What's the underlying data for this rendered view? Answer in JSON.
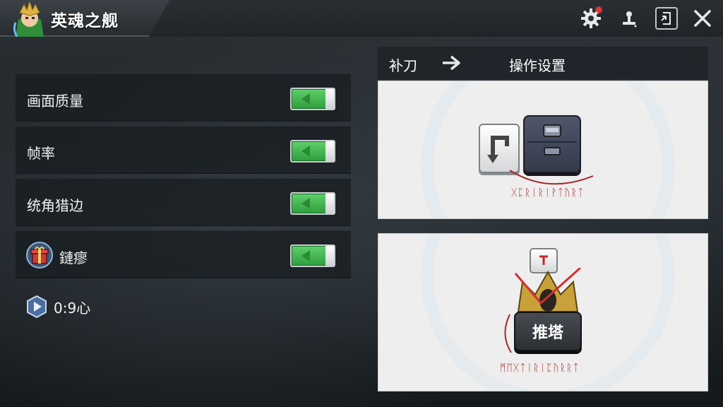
{
  "header": {
    "title": "英魂之舰",
    "icons": [
      "avatar-portrait",
      "gear-icon",
      "joystick-icon",
      "exit-to-icon",
      "close-icon"
    ]
  },
  "settings": {
    "rows": [
      {
        "label": "画面质量",
        "enabled": true
      },
      {
        "label": "帧率",
        "enabled": true
      },
      {
        "label": "统角猎边",
        "enabled": true
      },
      {
        "label": "鏈瘳",
        "enabled": true,
        "icon": "gift-box-icon"
      }
    ],
    "footer": {
      "icon": "play-badge-icon",
      "value": "0:9心"
    }
  },
  "right_panel": {
    "tab_left": "补刀",
    "tab_right": "操作设置",
    "card1": {
      "rune_text": "ᚷᛈᚱᛁᚱᛁᚹᛏᚢᚱᛏ"
    },
    "card2": {
      "key_label": "推塔",
      "rune_text": "ᛗᛖᚷᛏᛁᚱᛁᛈᚢᚱᚱᛏ"
    }
  },
  "colors": {
    "toggle_on": "#3fb34f",
    "accent_red": "#a42a2a",
    "notification_dot": "#e53935"
  }
}
